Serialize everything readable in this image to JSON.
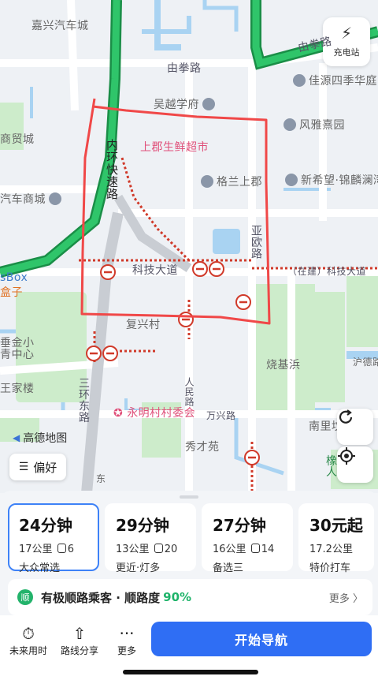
{
  "map": {
    "charge_button": {
      "icon": "charging-bolt-icon",
      "label": "充电站"
    },
    "labels": {
      "jiaxing_car_city": "嘉兴汽车城",
      "youquan_road_top": "由拳路",
      "youquan_road_left": "由拳路",
      "jiayuan_siji": "佳源四季华庭",
      "wuyue_xuefu": "吴越学府",
      "fengya_xiyuan": "风雅熹园",
      "shangdu_supermarket": "上郡生鲜超市",
      "shangmao_city": "商贸城",
      "gesan_shangjun": "格兰上郡",
      "xinxiwang": "新希望·锦麟澜湾",
      "car_mall": "汽车商城",
      "neihuan_expressway": "内环快速路",
      "yaou_road": "亚欧路",
      "keji_avenue": "科技大道",
      "keji_avenue_building": "（在建）科技大道",
      "box_label": "sBox",
      "hezi": "盒子",
      "fuxing_village": "复兴村",
      "shaojiabang": "烧基浜",
      "huduxiang": "沪德路",
      "wangjialou": "王家楼",
      "jin_center": "垂金小\n青中心",
      "sanhuan_east_road": "三环东路",
      "yongming_committee": "永明村村委会",
      "renmin_road": "人民路",
      "wanxing_road": "万兴路",
      "nanli": "南里坟",
      "xiucai_yuan": "秀才苑",
      "dongdong": "东",
      "heyuan": "橡\n人"
    },
    "amap_logo": "高德地图",
    "preference_button": "偏好",
    "refresh_icon": "refresh-icon",
    "locate_icon": "locate-icon"
  },
  "routes": [
    {
      "time": "24分钟",
      "distance": "17公里",
      "lights": "6",
      "desc": "大众常选",
      "selected": true
    },
    {
      "time": "29分钟",
      "distance": "13公里",
      "lights": "20",
      "desc": "更近·灯多",
      "selected": false
    },
    {
      "time": "27分钟",
      "distance": "16公里",
      "lights": "14",
      "desc": "备选三",
      "selected": false
    },
    {
      "time": "30元起",
      "distance": "17.2公里",
      "desc": "特价打车",
      "selected": false
    }
  ],
  "shunlu": {
    "icon_text": "顺",
    "text": "有极顺路乘客 · 顺路度",
    "percent": "90%",
    "more": "更多 〉"
  },
  "bottom_bar": {
    "future_time": "未来用时",
    "route_share": "路线分享",
    "more": "更多",
    "start_nav": "开始导航"
  },
  "colors": {
    "accent": "#2f6ef4",
    "expressway": "#21b45c",
    "annotation": "#f04848"
  }
}
